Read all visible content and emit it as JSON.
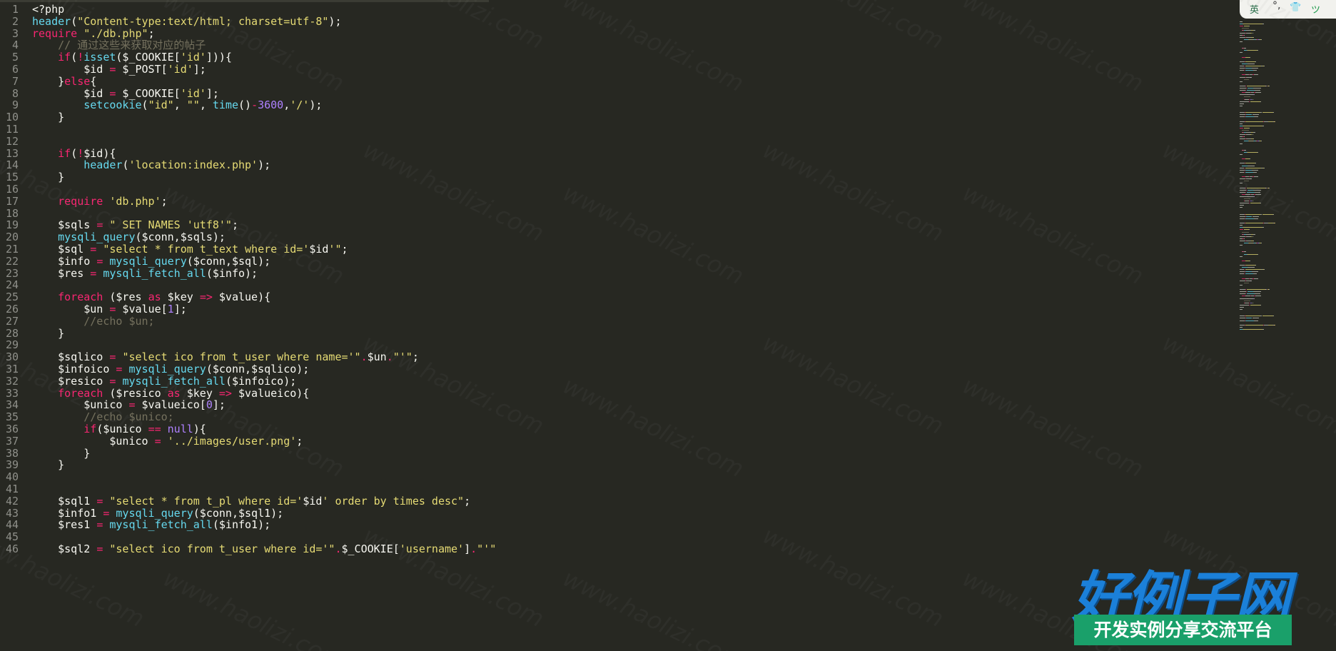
{
  "editor": {
    "lines": [
      [
        [
          "p",
          "<?php"
        ]
      ],
      [
        [
          "f",
          "header"
        ],
        [
          "p",
          "("
        ],
        [
          "s",
          "\"Content-type:text/html; charset=utf-8\""
        ],
        [
          "p",
          ");"
        ]
      ],
      [
        [
          "k",
          "require"
        ],
        [
          "p",
          " "
        ],
        [
          "s",
          "\"./db.php\""
        ],
        [
          "p",
          ";"
        ]
      ],
      [
        [
          "p",
          "    "
        ],
        [
          "c",
          "// 通过这些来获取对应的帖子"
        ]
      ],
      [
        [
          "p",
          "    "
        ],
        [
          "k",
          "if"
        ],
        [
          "p",
          "("
        ],
        [
          "k",
          "!"
        ],
        [
          "f",
          "isset"
        ],
        [
          "p",
          "($_COOKIE["
        ],
        [
          "s",
          "'id'"
        ],
        [
          "p",
          "])){"
        ]
      ],
      [
        [
          "p",
          "        $id "
        ],
        [
          "k",
          "="
        ],
        [
          "p",
          " $_POST["
        ],
        [
          "s",
          "'id'"
        ],
        [
          "p",
          "];"
        ]
      ],
      [
        [
          "p",
          "    }"
        ],
        [
          "k",
          "else"
        ],
        [
          "p",
          "{"
        ]
      ],
      [
        [
          "p",
          "        $id "
        ],
        [
          "k",
          "="
        ],
        [
          "p",
          " $_COOKIE["
        ],
        [
          "s",
          "'id'"
        ],
        [
          "p",
          "];"
        ]
      ],
      [
        [
          "p",
          "        "
        ],
        [
          "f",
          "setcookie"
        ],
        [
          "p",
          "("
        ],
        [
          "s",
          "\"id\""
        ],
        [
          "p",
          ", "
        ],
        [
          "s",
          "\"\""
        ],
        [
          "p",
          ", "
        ],
        [
          "f",
          "time"
        ],
        [
          "p",
          "()"
        ],
        [
          "k",
          "-"
        ],
        [
          "n",
          "3600"
        ],
        [
          "p",
          ","
        ],
        [
          "s",
          "'/'"
        ],
        [
          "p",
          ");"
        ]
      ],
      [
        [
          "p",
          "    }"
        ]
      ],
      [],
      [],
      [
        [
          "p",
          "    "
        ],
        [
          "k",
          "if"
        ],
        [
          "p",
          "("
        ],
        [
          "k",
          "!"
        ],
        [
          "p",
          "$id){"
        ]
      ],
      [
        [
          "p",
          "        "
        ],
        [
          "f",
          "header"
        ],
        [
          "p",
          "("
        ],
        [
          "s",
          "'location:index.php'"
        ],
        [
          "p",
          ");"
        ]
      ],
      [
        [
          "p",
          "    }"
        ]
      ],
      [],
      [
        [
          "p",
          "    "
        ],
        [
          "k",
          "require"
        ],
        [
          "p",
          " "
        ],
        [
          "s",
          "'db.php'"
        ],
        [
          "p",
          ";"
        ]
      ],
      [],
      [
        [
          "p",
          "    $sqls "
        ],
        [
          "k",
          "="
        ],
        [
          "p",
          " "
        ],
        [
          "s",
          "\" SET NAMES 'utf8'\""
        ],
        [
          "p",
          ";"
        ]
      ],
      [
        [
          "p",
          "    "
        ],
        [
          "f",
          "mysqli_query"
        ],
        [
          "p",
          "($conn,$sqls);"
        ]
      ],
      [
        [
          "p",
          "    $sql "
        ],
        [
          "k",
          "="
        ],
        [
          "p",
          " "
        ],
        [
          "s",
          "\"select * from t_text where id='"
        ],
        [
          "p",
          "$id"
        ],
        [
          "s",
          "'\""
        ],
        [
          "p",
          ";"
        ]
      ],
      [
        [
          "p",
          "    $info "
        ],
        [
          "k",
          "="
        ],
        [
          "p",
          " "
        ],
        [
          "f",
          "mysqli_query"
        ],
        [
          "p",
          "($conn,$sql);"
        ]
      ],
      [
        [
          "p",
          "    $res "
        ],
        [
          "k",
          "="
        ],
        [
          "p",
          " "
        ],
        [
          "f",
          "mysqli_fetch_all"
        ],
        [
          "p",
          "($info);"
        ]
      ],
      [],
      [
        [
          "p",
          "    "
        ],
        [
          "k",
          "foreach"
        ],
        [
          "p",
          " ($res "
        ],
        [
          "k",
          "as"
        ],
        [
          "p",
          " $key "
        ],
        [
          "k",
          "=>"
        ],
        [
          "p",
          " $value){"
        ]
      ],
      [
        [
          "p",
          "        $un "
        ],
        [
          "k",
          "="
        ],
        [
          "p",
          " $value["
        ],
        [
          "n",
          "1"
        ],
        [
          "p",
          "];"
        ]
      ],
      [
        [
          "p",
          "        "
        ],
        [
          "c",
          "//echo $un;"
        ]
      ],
      [
        [
          "p",
          "    }"
        ]
      ],
      [],
      [
        [
          "p",
          "    $sqlico "
        ],
        [
          "k",
          "="
        ],
        [
          "p",
          " "
        ],
        [
          "s",
          "\"select ico from t_user where name='\""
        ],
        [
          "k",
          "."
        ],
        [
          "p",
          "$un"
        ],
        [
          "k",
          "."
        ],
        [
          "s",
          "\"'\""
        ],
        [
          "p",
          ";"
        ]
      ],
      [
        [
          "p",
          "    $infoico "
        ],
        [
          "k",
          "="
        ],
        [
          "p",
          " "
        ],
        [
          "f",
          "mysqli_query"
        ],
        [
          "p",
          "($conn,$sqlico);"
        ]
      ],
      [
        [
          "p",
          "    $resico "
        ],
        [
          "k",
          "="
        ],
        [
          "p",
          " "
        ],
        [
          "f",
          "mysqli_fetch_all"
        ],
        [
          "p",
          "($infoico);"
        ]
      ],
      [
        [
          "p",
          "    "
        ],
        [
          "k",
          "foreach"
        ],
        [
          "p",
          " ($resico "
        ],
        [
          "k",
          "as"
        ],
        [
          "p",
          " $key "
        ],
        [
          "k",
          "=>"
        ],
        [
          "p",
          " $valueico){"
        ]
      ],
      [
        [
          "p",
          "        $unico "
        ],
        [
          "k",
          "="
        ],
        [
          "p",
          " $valueico["
        ],
        [
          "n",
          "0"
        ],
        [
          "p",
          "];"
        ]
      ],
      [
        [
          "p",
          "        "
        ],
        [
          "c",
          "//echo $unico;"
        ]
      ],
      [
        [
          "p",
          "        "
        ],
        [
          "k",
          "if"
        ],
        [
          "p",
          "($unico "
        ],
        [
          "k",
          "=="
        ],
        [
          "p",
          " "
        ],
        [
          "n",
          "null"
        ],
        [
          "p",
          "){"
        ]
      ],
      [
        [
          "p",
          "            $unico "
        ],
        [
          "k",
          "="
        ],
        [
          "p",
          " "
        ],
        [
          "s",
          "'../images/user.png'"
        ],
        [
          "p",
          ";"
        ]
      ],
      [
        [
          "p",
          "        }"
        ]
      ],
      [
        [
          "p",
          "    }"
        ]
      ],
      [],
      [],
      [
        [
          "p",
          "    $sql1 "
        ],
        [
          "k",
          "="
        ],
        [
          "p",
          " "
        ],
        [
          "s",
          "\"select * from t_pl where id='"
        ],
        [
          "p",
          "$id"
        ],
        [
          "s",
          "' order by times desc\""
        ],
        [
          "p",
          ";"
        ]
      ],
      [
        [
          "p",
          "    $info1 "
        ],
        [
          "k",
          "="
        ],
        [
          "p",
          " "
        ],
        [
          "f",
          "mysqli_query"
        ],
        [
          "p",
          "($conn,$sql1);"
        ]
      ],
      [
        [
          "p",
          "    $res1 "
        ],
        [
          "k",
          "="
        ],
        [
          "p",
          " "
        ],
        [
          "f",
          "mysqli_fetch_all"
        ],
        [
          "p",
          "($info1);"
        ]
      ],
      [],
      [
        [
          "p",
          "    $sql2 "
        ],
        [
          "k",
          "="
        ],
        [
          "p",
          " "
        ],
        [
          "s",
          "\"select ico from t_user where id='\""
        ],
        [
          "k",
          "."
        ],
        [
          "p",
          "$_COOKIE["
        ],
        [
          "s",
          "'username'"
        ],
        [
          "p",
          "]"
        ],
        [
          "k",
          "."
        ],
        [
          "s",
          "\"'\""
        ]
      ]
    ]
  },
  "ime": {
    "mode_label": "英",
    "punct": "°,",
    "skin_icon": "shirt-icon",
    "end_label": "ツ"
  },
  "watermark": {
    "text": "www.haolizi.com"
  },
  "logo": {
    "title": "好例子网",
    "tagline": "开发实例分享交流平台",
    "colors": {
      "title": "#1b80d9",
      "tagline_bg": "#1aa06a"
    }
  },
  "theme": {
    "background": "#272822",
    "plain": "#f8f8f2",
    "keyword": "#f92672",
    "function": "#66d9ef",
    "string": "#e6db74",
    "number": "#ae81ff",
    "comment": "#75715e",
    "gutter": "#8f908a"
  }
}
